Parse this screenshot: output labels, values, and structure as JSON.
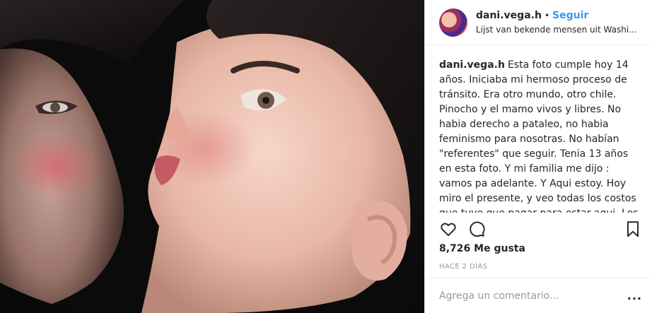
{
  "post": {
    "username": "dani.vega.h",
    "separator": "•",
    "follow_label": "Seguir",
    "location": "Lijst van bekende mensen uit Washingt...",
    "caption_user": "dani.vega.h",
    "caption_text": "Esta foto cumple hoy 14 años. Iniciaba mi hermoso proceso de tránsito. Era otro mundo, otro chile. Pinocho y el mamo vivos y libres. No habia derecho a pataleo, no habia feminismo para nosotras. No habían \"referentes\" que seguir. Tenia 13 años en esta foto. Y mi familia me dijo : vamos pa adelante. Y Aqui estoy. Hoy miro el presente, y veo todas los costos que tuve que pagar para estar aqui. Los pagaría de nuevo, para ver que nadie mas los pague.",
    "likes": "8,726 Me gusta",
    "time": "HACE 2 DÍAS",
    "comment_placeholder": "Agrega un comentario...",
    "more_label": "..."
  },
  "icons": {
    "like": "heart-icon",
    "comment": "comment-icon",
    "save": "bookmark-icon"
  },
  "colors": {
    "link_blue": "#3897f0",
    "text": "#262626",
    "muted": "#999999",
    "divider": "#efefef"
  }
}
